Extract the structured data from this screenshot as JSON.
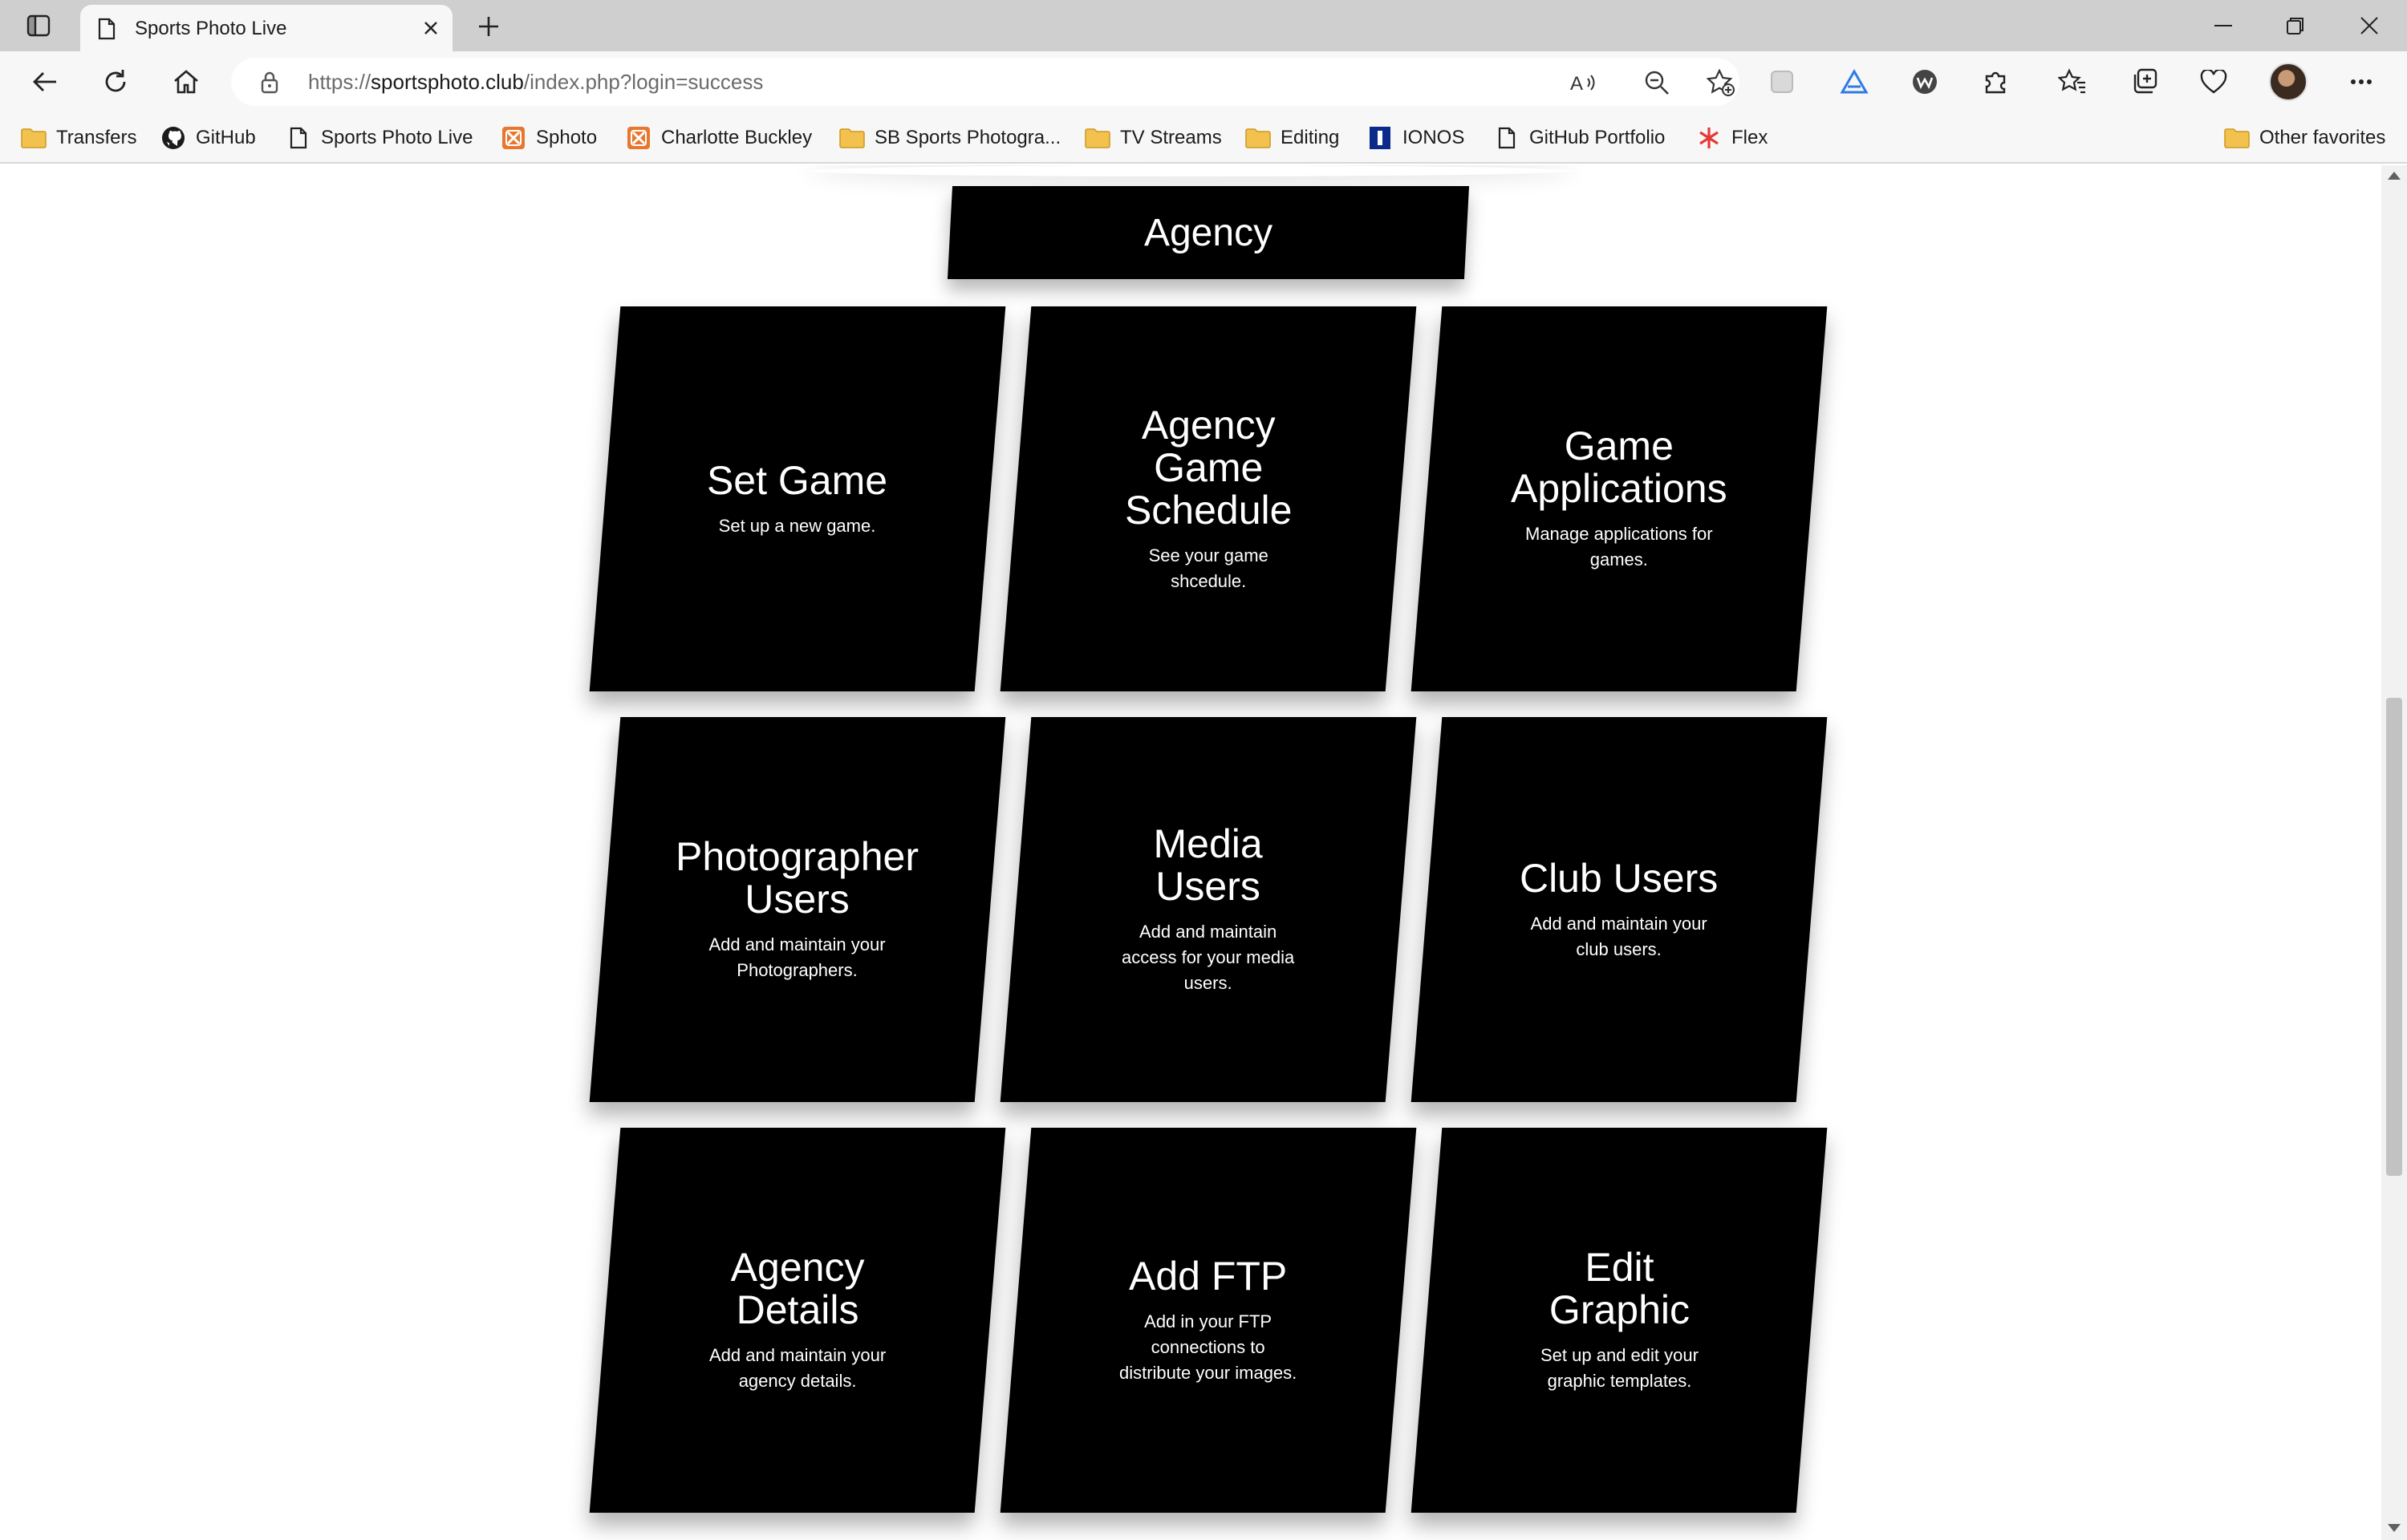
{
  "browser": {
    "tab_title": "Sports Photo Live",
    "url_prefix": "https://",
    "url_domain": "sportsphoto.club",
    "url_path": "/index.php?login=success"
  },
  "favorites": [
    {
      "label": "Transfers",
      "icon": "folder-icon"
    },
    {
      "label": "GitHub",
      "icon": "github-icon"
    },
    {
      "label": "Sports Photo Live",
      "icon": "page-icon"
    },
    {
      "label": "Sphoto",
      "icon": "xampp-icon"
    },
    {
      "label": "Charlotte Buckley",
      "icon": "xampp-icon"
    },
    {
      "label": "SB Sports Photogra...",
      "icon": "folder-icon"
    },
    {
      "label": "TV Streams",
      "icon": "folder-icon"
    },
    {
      "label": "Editing",
      "icon": "folder-icon"
    },
    {
      "label": "IONOS",
      "icon": "ionos-icon"
    },
    {
      "label": "GitHub Portfolio",
      "icon": "page-icon"
    },
    {
      "label": "Flex",
      "icon": "flex-icon"
    }
  ],
  "other_favorites": "Other favorites",
  "page": {
    "header": "Agency",
    "tiles": [
      {
        "title": "Set Game",
        "desc": "Set up a new game."
      },
      {
        "title": "Agency\nGame\nSchedule",
        "desc": "See your game\nshcedule."
      },
      {
        "title": "Game\nApplications",
        "desc": "Manage applications for\ngames."
      },
      {
        "title": "Photographer\nUsers",
        "desc": "Add and maintain your\nPhotographers."
      },
      {
        "title": "Media\nUsers",
        "desc": "Add and maintain\naccess for your media\nusers."
      },
      {
        "title": "Club Users",
        "desc": "Add and maintain your\nclub users."
      },
      {
        "title": "Agency\nDetails",
        "desc": "Add and maintain your\nagency details."
      },
      {
        "title": "Add FTP",
        "desc": "Add in your FTP\nconnections to\ndistribute your images."
      },
      {
        "title": "Edit\nGraphic",
        "desc": "Set up and edit your\ngraphic templates."
      }
    ]
  },
  "colors": {
    "tile_bg": "#000000",
    "tile_text": "#ffffff",
    "folder": "#f2c14e",
    "xampp": "#e8772e",
    "ionos": "#0b2a8a",
    "flex": "#e53935"
  }
}
